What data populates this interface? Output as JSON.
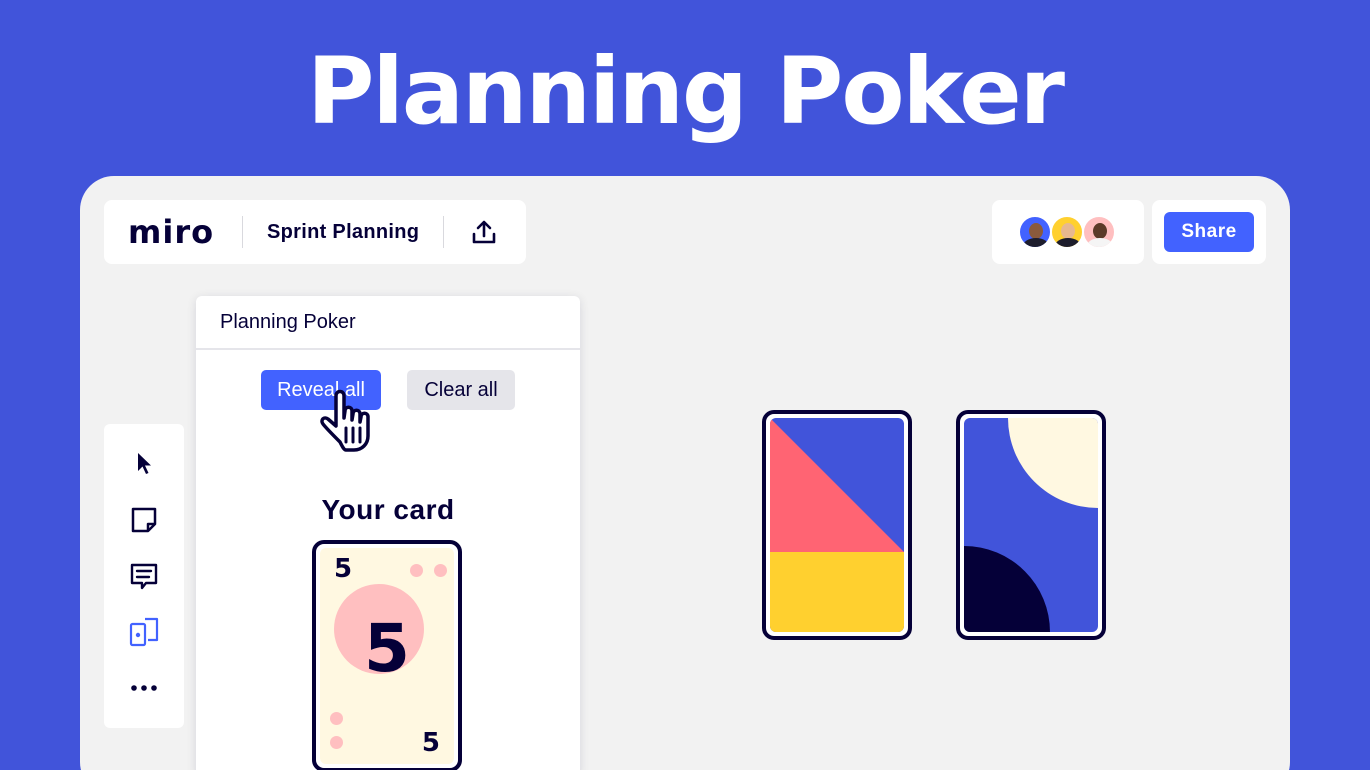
{
  "hero": {
    "title": "Planning Poker"
  },
  "topbar": {
    "logo": "miro",
    "board_name": "Sprint Planning",
    "upload_icon": "upload-icon",
    "share_label": "Share"
  },
  "collaborators": [
    {
      "name": "avatar-1",
      "bg": "#4262ff",
      "skin": "#8a5a3c"
    },
    {
      "name": "avatar-2",
      "bg": "#ffd02f",
      "skin": "#e7b88f"
    },
    {
      "name": "avatar-3",
      "bg": "#ffbfc0",
      "skin": "#5c3a28"
    }
  ],
  "toolbar": {
    "tools": [
      {
        "name": "select-tool",
        "icon": "cursor-icon"
      },
      {
        "name": "sticky-note-tool",
        "icon": "sticky-note-icon"
      },
      {
        "name": "comment-tool",
        "icon": "comment-icon"
      },
      {
        "name": "cards-tool",
        "icon": "cards-icon"
      },
      {
        "name": "more-tools",
        "icon": "more-icon"
      }
    ]
  },
  "panel": {
    "title": "Planning Poker",
    "reveal_label": "Reveal all",
    "clear_label": "Clear all",
    "your_card_label": "Your card",
    "card_value": "5"
  },
  "colors": {
    "accent": "#4262ff",
    "background": "#4154da",
    "ink": "#050038",
    "card_red": "#ff6473",
    "card_yellow": "#ffd02f",
    "card_cream": "#fff8e1",
    "card_pink": "#ffbfc0"
  }
}
